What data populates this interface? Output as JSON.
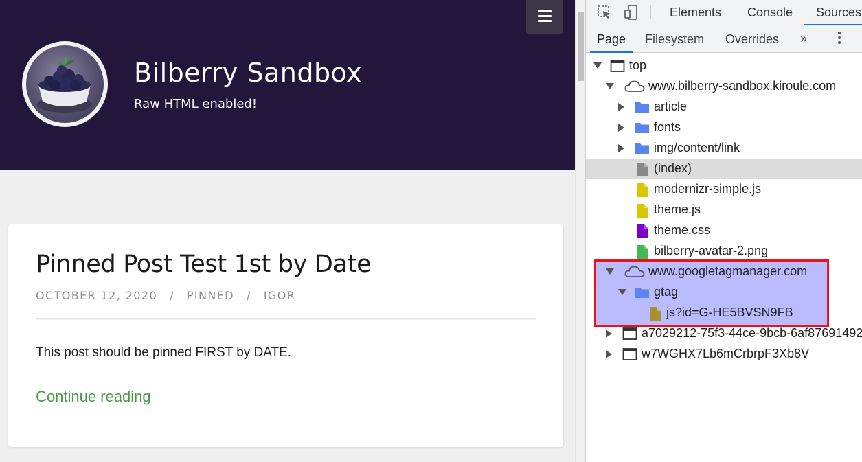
{
  "site": {
    "title": "Bilberry Sandbox",
    "tagline": "Raw HTML enabled!",
    "menu_icon": "hamburger-icon",
    "post": {
      "title": "Pinned Post Test 1st by Date",
      "date": "OCTOBER 12, 2020",
      "category": "PINNED",
      "author": "IGOR",
      "separator": "/",
      "excerpt": "This post should be pinned FIRST by DATE.",
      "continue_label": "Continue reading"
    },
    "colors": {
      "header_bg": "#22163a",
      "link": "#4a9a4a"
    }
  },
  "devtools": {
    "tabs": [
      "Elements",
      "Console",
      "Sources"
    ],
    "active_tab": "Sources",
    "sources_tabs": [
      "Page",
      "Filesystem",
      "Overrides"
    ],
    "active_sources_tab": "Page",
    "more_label": "»",
    "tree": [
      {
        "label": "top",
        "icon": "frame-icon",
        "expanded": true
      },
      {
        "label": "www.bilberry-sandbox.kiroule.com",
        "icon": "cloud-icon",
        "expanded": true
      },
      {
        "label": "article",
        "icon": "folder-icon",
        "expanded": false
      },
      {
        "label": "fonts",
        "icon": "folder-icon",
        "expanded": false
      },
      {
        "label": "img/content/link",
        "icon": "folder-icon",
        "expanded": false
      },
      {
        "label": "(index)",
        "icon": "file-icon",
        "color": "#888888",
        "selected": true
      },
      {
        "label": "modernizr-simple.js",
        "icon": "file-icon",
        "color": "#d8c600"
      },
      {
        "label": "theme.js",
        "icon": "file-icon",
        "color": "#d8c600"
      },
      {
        "label": "theme.css",
        "icon": "file-icon",
        "color": "#7b00c8"
      },
      {
        "label": "bilberry-avatar-2.png",
        "icon": "file-icon",
        "color": "#3fb950"
      },
      {
        "label": "www.googletagmanager.com",
        "icon": "cloud-icon",
        "expanded": true
      },
      {
        "label": "gtag",
        "icon": "folder-icon",
        "expanded": true
      },
      {
        "label": "js?id=G-HE5BVSN9FB",
        "icon": "file-icon",
        "color": "#a89030"
      },
      {
        "label": "a7029212-75f3-44ce-9bcb-6af87691492",
        "icon": "frame-icon",
        "expanded": false
      },
      {
        "label": "w7WGHX7Lb6mCrbrpF3Xb8V",
        "icon": "frame-icon",
        "expanded": false
      }
    ],
    "highlight_color": "#e8151e"
  }
}
